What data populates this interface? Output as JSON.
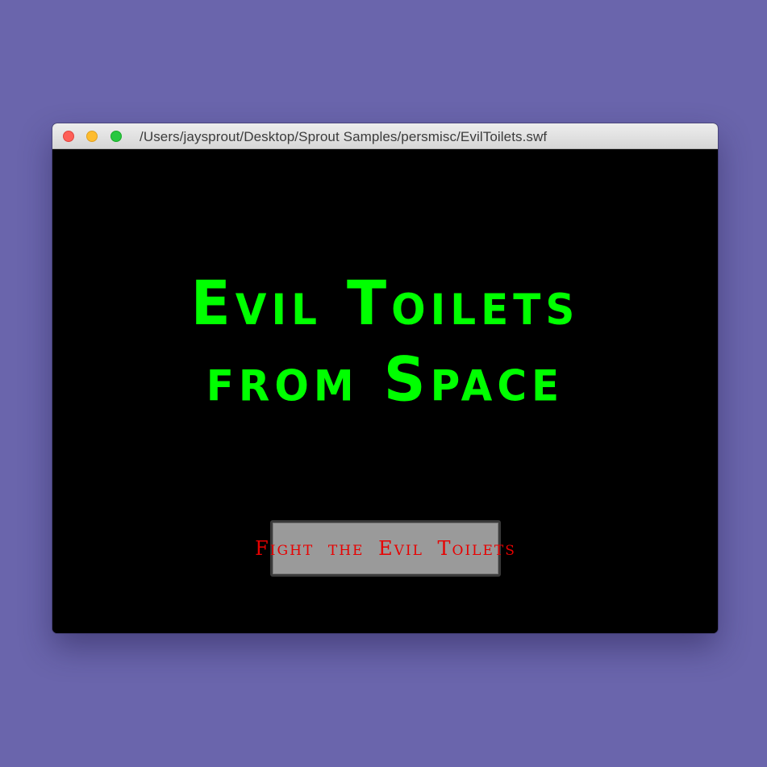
{
  "window": {
    "title": "/Users/jaysprout/Desktop/Sprout Samples/persmisc/EvilToilets.swf",
    "buttons": {
      "close_icon": "close-icon",
      "minimize_icon": "minimize-icon",
      "zoom_icon": "zoom-icon"
    }
  },
  "game": {
    "title_line1": "Evil Toilets",
    "title_line2": "from Space",
    "fight_button_label": "Fight the Evil Toilets"
  },
  "colors": {
    "desktop_background": "#6A65AC",
    "stage_background": "#000000",
    "title_text": "#00FF00",
    "button_background": "#9A9A9A",
    "button_text": "#E80000"
  }
}
